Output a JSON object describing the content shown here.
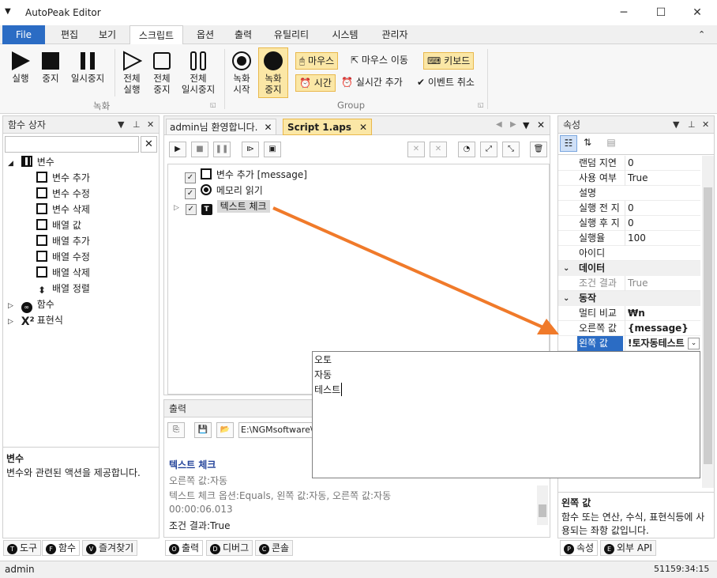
{
  "app": {
    "title": "AutoPeak Editor"
  },
  "ribbon_tabs": [
    "File",
    "편집",
    "보기",
    "스크립트",
    "옵션",
    "출력",
    "유틸리티",
    "시스템",
    "관리자"
  ],
  "ribbon": {
    "run": "실행",
    "stop": "중지",
    "pause": "일시중지",
    "all_run": [
      "전체",
      "실행"
    ],
    "all_stop": [
      "전체",
      "중지"
    ],
    "all_pause": [
      "전체",
      "일시중지"
    ],
    "rec_start": [
      "녹화",
      "시작"
    ],
    "rec_stop": [
      "녹화",
      "중지"
    ],
    "group_record": "녹화",
    "group_main": "Group",
    "mouse": "마우스",
    "mouse_move": "마우스 이동",
    "keyboard": "키보드",
    "time": "시간",
    "realtime_add": "실시간 추가",
    "event_cancel": "이벤트 취소"
  },
  "left": {
    "title": "함수 상자",
    "search_value": "",
    "tree": {
      "variables": "변수",
      "var_add": "변수 추가",
      "var_edit": "변수 수정",
      "var_delete": "변수 삭제",
      "arr_value": "배열 값",
      "arr_add": "배열 추가",
      "arr_edit": "배열 수정",
      "arr_delete": "배열 삭제",
      "arr_sort": "배열 정렬",
      "functions": "함수",
      "expressions": "표현식"
    },
    "desc_title": "변수",
    "desc_text": "변수와 관련된 액션을 제공합니다.",
    "tabs": [
      "도구",
      "함수",
      "즐겨찾기"
    ]
  },
  "doc_tabs": [
    "admin님 환영합니다.",
    "Script 1.aps"
  ],
  "script": {
    "items": [
      {
        "label": "변수 추가 [message]"
      },
      {
        "label": "메모리 읽기"
      },
      {
        "label": "텍스트 체크"
      }
    ]
  },
  "output": {
    "title": "출력",
    "path": "E:\\NGMsoftware\\",
    "lines": [
      {
        "text": "텍스트 체크"
      },
      {
        "text": "오른쪽 값:자동"
      },
      {
        "text": "텍스트 체크 옵션:Equals, 왼쪽 값:자동, 오른쪽 값:자동"
      },
      {
        "text": "00:00:06.013"
      },
      {
        "text": "조건 결과:True"
      }
    ],
    "tabs": [
      "출력",
      "디버그",
      "콘솔"
    ]
  },
  "popup": {
    "lines": [
      "오토",
      "자동",
      "테스트"
    ]
  },
  "props": {
    "title": "속성",
    "rows1": [
      {
        "k": "랜덤 지연",
        "v": "0"
      },
      {
        "k": "사용 여부",
        "v": "True"
      },
      {
        "k": "설명",
        "v": ""
      },
      {
        "k": "실행 전 지",
        "v": "0"
      },
      {
        "k": "실행 후 지",
        "v": "0"
      },
      {
        "k": "실행율",
        "v": "100"
      },
      {
        "k": "아이디",
        "v": ""
      }
    ],
    "cat_data": "데이터",
    "data_rows": [
      {
        "k": "조건 결과",
        "v": "True"
      }
    ],
    "cat_action": "동작",
    "action_rows": [
      {
        "k": "멀티 비교",
        "v": "₩n"
      },
      {
        "k": "오른쪽 값",
        "v": "{message}"
      },
      {
        "k": "왼쪽 값",
        "v": "!토자동테스트"
      }
    ],
    "desc_title": "왼쪽 값",
    "desc_text": "함수 또는 연산, 수식, 표현식등에 사용되는 좌항 값입니다.",
    "tabs": [
      "속성",
      "외부 API"
    ]
  },
  "status": {
    "user": "admin",
    "time": "51159:34:15"
  },
  "colors": {
    "accent": "#2b6cc4",
    "arrow": "#f07a2a",
    "highlight": "#fbe7a6"
  }
}
